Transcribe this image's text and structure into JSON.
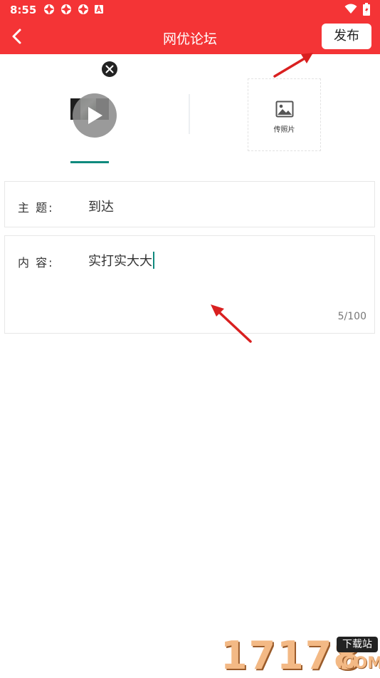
{
  "status_bar": {
    "time": "8:55"
  },
  "header": {
    "title": "网优论坛",
    "publish_label": "发布"
  },
  "media": {
    "add_photo_label": "传照片"
  },
  "form": {
    "subject_label": "主  题:",
    "subject_value": "到达",
    "content_label": "内  容:",
    "content_value": "实打实大大",
    "char_counter": "5/100"
  },
  "watermark": {
    "digits": "17178",
    "site_cn": "下载站",
    "site_suffix": ".COM"
  },
  "colors": {
    "header": "#f43436",
    "accent": "#0f8a7e",
    "annotation_arrow": "#d92020"
  }
}
